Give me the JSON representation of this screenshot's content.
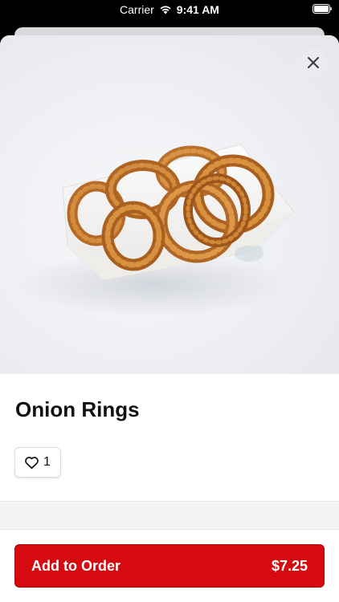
{
  "status_bar": {
    "carrier": "Carrier",
    "time": "9:41 AM",
    "wifi_icon": "wifi-icon",
    "battery_icon": "battery-icon"
  },
  "item": {
    "name": "Onion Rings",
    "like_count": "1",
    "like_icon": "heart-outline-icon",
    "image": "onion-rings-in-paper-boat"
  },
  "close_icon": "close-icon",
  "order_button": {
    "label": "Add to Order",
    "price": "$7.25",
    "color": "#d60a0f"
  }
}
